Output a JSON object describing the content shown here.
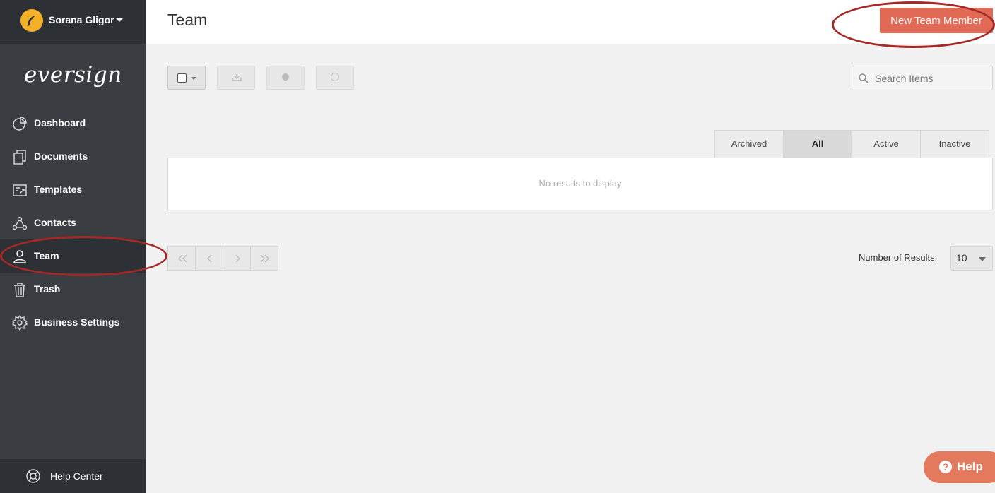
{
  "user": {
    "name": "Sorana Gligor"
  },
  "brand": {
    "logo_text": "eversign",
    "accent": "#e06a55",
    "annotation_color": "#a52a27"
  },
  "sidebar": {
    "items": [
      {
        "label": "Dashboard",
        "icon": "dashboard-pie-icon",
        "active": false
      },
      {
        "label": "Documents",
        "icon": "documents-icon",
        "active": false
      },
      {
        "label": "Templates",
        "icon": "templates-icon",
        "active": false
      },
      {
        "label": "Contacts",
        "icon": "contacts-icon",
        "active": false
      },
      {
        "label": "Team",
        "icon": "team-icon",
        "active": true
      },
      {
        "label": "Trash",
        "icon": "trash-icon",
        "active": false
      },
      {
        "label": "Business Settings",
        "icon": "gear-icon",
        "active": false
      }
    ],
    "help_center": "Help Center"
  },
  "header": {
    "title": "Team",
    "new_button": "New Team Member"
  },
  "toolbar": {
    "search_placeholder": "Search Items"
  },
  "filters": {
    "tabs": [
      "Archived",
      "All",
      "Active",
      "Inactive"
    ],
    "active": "All"
  },
  "results": {
    "empty_text": "No results to display"
  },
  "pagination": {
    "label": "Number of Results:",
    "value": "10"
  },
  "help": {
    "label": "Help"
  }
}
